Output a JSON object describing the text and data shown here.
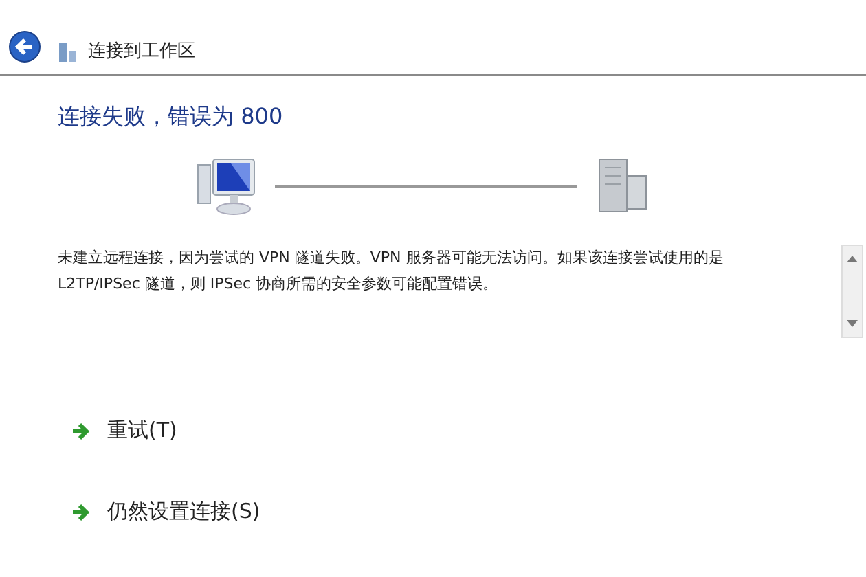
{
  "window": {
    "title": "连接到工作区"
  },
  "heading": "连接失败，错误为 800",
  "message": "未建立远程连接，因为尝试的 VPN 隧道失败。VPN 服务器可能无法访问。如果该连接尝试使用的是 L2TP/IPSec 隧道，则 IPSec 协商所需的安全参数可能配置错误。",
  "commands": [
    {
      "label": "重试(T)"
    },
    {
      "label": "仍然设置连接(S)"
    }
  ]
}
